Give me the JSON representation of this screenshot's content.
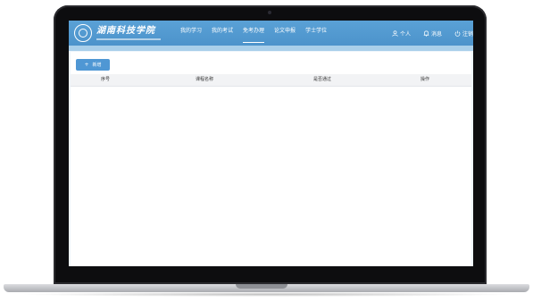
{
  "header": {
    "school_name": "湖南科技学院",
    "nav": [
      {
        "label": "我的学习",
        "active": false
      },
      {
        "label": "我的考试",
        "active": false
      },
      {
        "label": "免考办理",
        "active": true
      },
      {
        "label": "论文申报",
        "active": false
      },
      {
        "label": "学士学位",
        "active": false
      }
    ],
    "user_links": {
      "profile_label": "个人",
      "profile_icon": "user-icon",
      "messages_label": "消息",
      "messages_icon": "bell-icon",
      "logout_label": "注销",
      "logout_icon": "power-icon"
    },
    "accent_color": "#4c93cb"
  },
  "toolbar": {
    "add_label": "新增",
    "add_icon": "plus-icon"
  },
  "table": {
    "columns": [
      "序号",
      "课程名称",
      "是否通过",
      "操作"
    ],
    "rows": []
  }
}
